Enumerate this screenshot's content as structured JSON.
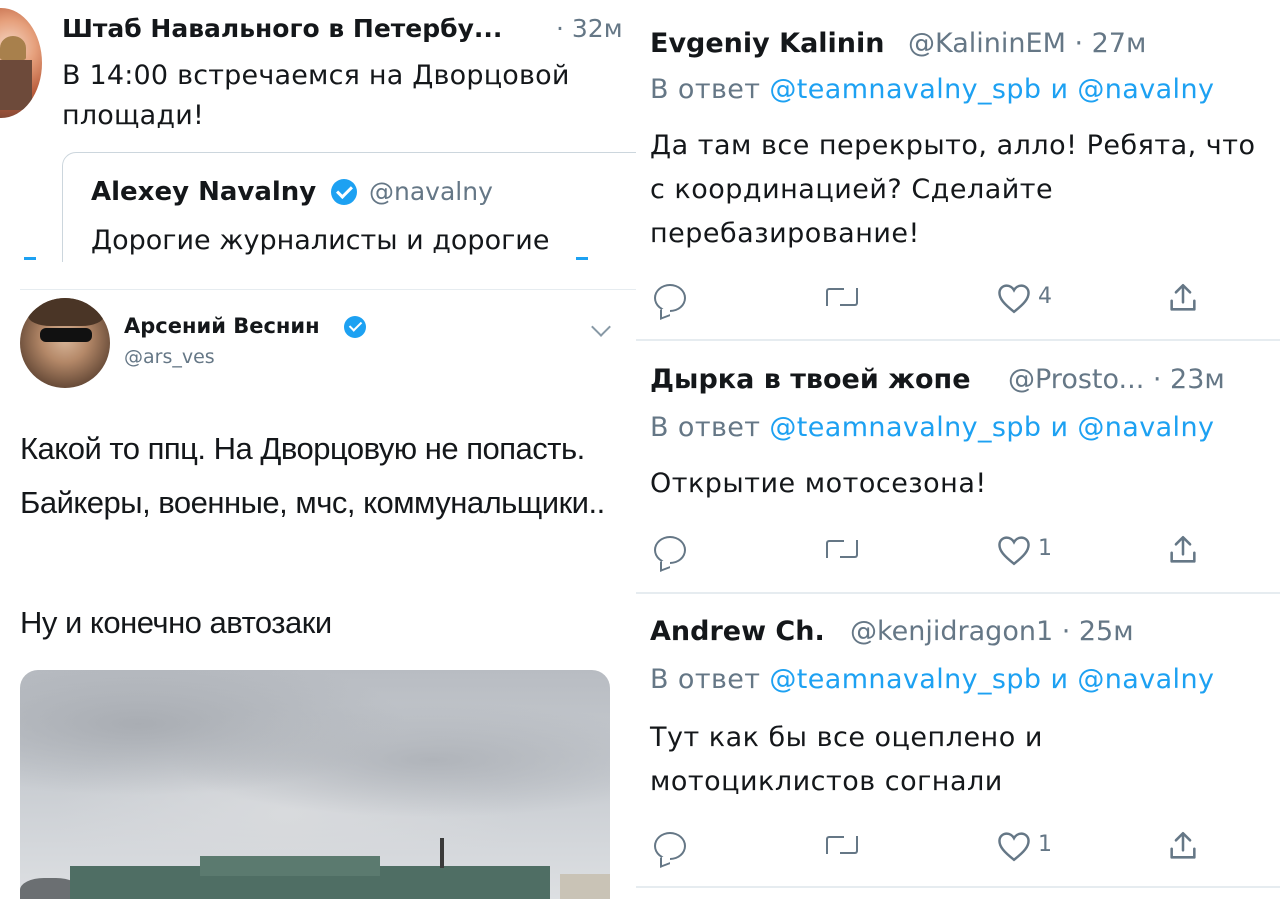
{
  "top_left_tweet": {
    "account_name": "Штаб Навального в Петербу...",
    "time": "· 32м",
    "text": "В 14:00 встречаемся на Дворцовой площади!",
    "quoted": {
      "name": "Alexey Navalny",
      "handle": "@navalny",
      "text": "Дорогие журналисты и дорогие"
    }
  },
  "bottom_left_tweet": {
    "name": "Арсений Веснин",
    "handle": "@ars_ves",
    "paragraph_1": "Какой то ппц. На Дворцовую не попасть. Байкеры, военные, мчс, коммунальщики..",
    "paragraph_2": "Ну и конечно автозаки"
  },
  "replies": [
    {
      "name": "Evgeniy Kalinin",
      "handle_time": "@KalininEM · 27м",
      "reply_prefix": "В ответ",
      "reply_to_1": "@teamnavalny_spb",
      "reply_and": "и",
      "reply_to_2": "@navalny",
      "text": "Да там все перекрыто, алло! Ребята, что с координацией? Сделайте перебазирование!",
      "likes": "4"
    },
    {
      "name": "Дырка в твоей жопе",
      "handle_time": "@Prosto... · 23м",
      "reply_prefix": "В ответ",
      "reply_to_1": "@teamnavalny_spb",
      "reply_and": "и",
      "reply_to_2": "@navalny",
      "text": "Открытие мотосезона!",
      "likes": "1"
    },
    {
      "name": "Andrew Ch.",
      "handle_time": "@kenjidragon1 · 25м",
      "reply_prefix": "В ответ",
      "reply_to_1": "@teamnavalny_spb",
      "reply_and": "и",
      "reply_to_2": "@navalny",
      "text": "Тут как бы все оцеплено и мотоциклистов согнали",
      "likes": "1"
    }
  ],
  "icons": {
    "reply": "reply-icon",
    "retweet": "retweet-icon",
    "like": "heart-icon",
    "share": "share-icon",
    "verified": "verified-badge-icon",
    "chevron": "chevron-down-icon"
  },
  "colors": {
    "link": "#1da1f2",
    "secondary": "#657786",
    "text": "#14171a",
    "border": "#e6ecf0"
  }
}
